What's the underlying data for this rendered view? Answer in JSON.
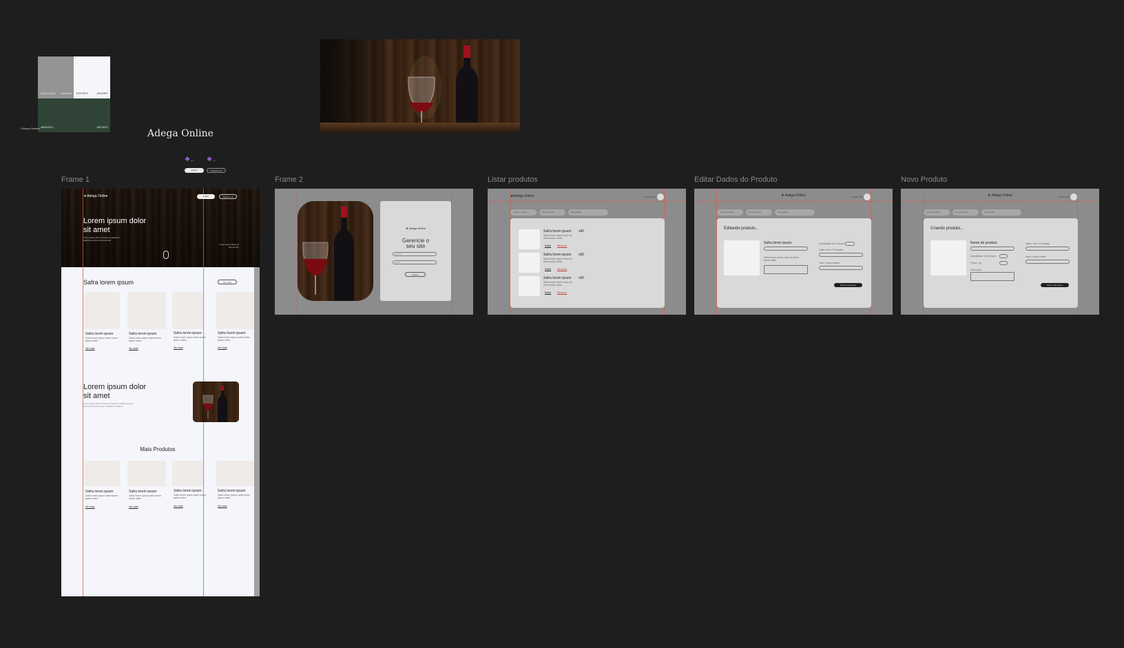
{
  "palette": {
    "caption": "Primary Swatch",
    "swatches": [
      {
        "label": "AADADAD0",
        "hex": "#949494",
        "color": "#949494"
      },
      {
        "label": "EFF3FF0",
        "hex": "#F4F6FF",
        "color": "#f4f6fb"
      },
      {
        "label": "AB2D3C0",
        "hex": "#2F4A37",
        "color": "#2f4436"
      }
    ]
  },
  "brand": {
    "title": "Adega Online"
  },
  "components": {
    "items": [
      "Button",
      "Button"
    ],
    "buttons": [
      "Entrar",
      "Cadastre-se"
    ]
  },
  "frames": {
    "frame1": {
      "label": "Frame 1",
      "logo": "Adega Online",
      "nav_btn1": "Entrar",
      "nav_btn2": "Cadastre-se",
      "hero_title_line1": "Lorem ipsum dolor",
      "hero_title_line2": "sit amet",
      "hero_desc": "Lorem ipsum dolor sit amet consectetur adipiscing elit sed do eiusmod",
      "hero_side": "Lorem ipsum dolor sit amet lorem",
      "section_title": "Safra lorem ipsum",
      "section_btn": "Ver todos",
      "cards": [
        {
          "title": "Safra lorem ipsum",
          "desc": "Safra lorem ipsum safra lorem ipsum safra",
          "link": "Ver mais"
        },
        {
          "title": "Safra lorem ipsum",
          "desc": "Safra lorem ipsum safra lorem ipsum safra",
          "link": "Ver mais"
        },
        {
          "title": "Safra lorem ipsum",
          "desc": "Safra lorem ipsum safra lorem ipsum safra",
          "link": "Ver mais"
        },
        {
          "title": "Safra lorem ipsum",
          "desc": "Safra lorem ipsum safra lorem ipsum safra",
          "link": "Ver mais"
        }
      ],
      "feature_title_line1": "Lorem ipsum dolor",
      "feature_title_line2": "sit amet",
      "feature_desc": "Lorem ipsum dolor sit amet consectetur adipiscing elit sed do eiusmod tempor incididunt ut labore",
      "more_title": "Mais Produtos"
    },
    "frame2": {
      "label": "Frame 2",
      "logo": "Adega Online",
      "subtitle": "Gerencie o seu site",
      "title_line1": "Gerencie o",
      "title_line2": "seu site",
      "input1": "Usuário",
      "input2": "Senha",
      "button": "Entrar"
    },
    "list": {
      "label": "Listar produtos",
      "logo": "Adega Online",
      "user": "Usuário Admin",
      "tabs": [
        "Listar Produtos",
        "Novo Produto",
        "Navegação"
      ],
      "items": [
        {
          "title": "Safra lorem ipsum",
          "price": "x90",
          "desc": "Safra lorem ipsum dolor sit amet ipsum safra",
          "edit": "Editar",
          "remove": "Remover"
        },
        {
          "title": "Safra lorem ipsum",
          "price": "x90",
          "desc": "Safra lorem ipsum dolor sit amet ipsum safra",
          "edit": "Editar",
          "remove": "Remover"
        },
        {
          "title": "Safra lorem ipsum",
          "price": "x90",
          "desc": "Safra lorem ipsum dolor sit amet ipsum safra",
          "edit": "Editar",
          "remove": "Remover"
        }
      ]
    },
    "edit": {
      "label": "Editar Dados do Produto",
      "logo": "Adega Online",
      "user": "Usuário Admin",
      "tabs": [
        "Listar Produtos",
        "Novo Produto",
        "Navegação"
      ],
      "panel_title": "Editando produto...",
      "product_name": "Safra lorem ipsum",
      "product_desc": "Safra lorem ipsum dolor sit amet ipsum safra",
      "field1": "Quantidade em estoque",
      "field2": "Safra / Ano / Produção",
      "field3": "Valor / preço médio",
      "save": "Salvar alterações"
    },
    "new": {
      "label": "Novo Produto",
      "logo": "Adega Online",
      "user": "Usuário Admin",
      "tabs": [
        "Listar Produtos",
        "Novo Produto",
        "Navegação"
      ],
      "panel_title": "Criando produto...",
      "name_label": "Nome do produto",
      "field1": "Quantidade em estoque",
      "field2": "Preço / kg",
      "field3": "Descrição",
      "right1": "Safra / Ano / Produção",
      "right2": "Valor / preço médio",
      "save": "Salvar alterações"
    }
  }
}
